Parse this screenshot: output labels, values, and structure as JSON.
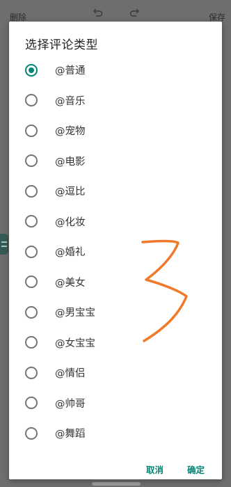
{
  "background": {
    "delete_label": "删除",
    "save_label": "保存"
  },
  "dialog": {
    "title": "选择评论类型",
    "options": [
      {
        "label": "@普通",
        "checked": true
      },
      {
        "label": "@音乐",
        "checked": false
      },
      {
        "label": "@宠物",
        "checked": false
      },
      {
        "label": "@电影",
        "checked": false
      },
      {
        "label": "@逗比",
        "checked": false
      },
      {
        "label": "@化妆",
        "checked": false
      },
      {
        "label": "@婚礼",
        "checked": false
      },
      {
        "label": "@美女",
        "checked": false
      },
      {
        "label": "@男宝宝",
        "checked": false
      },
      {
        "label": "@女宝宝",
        "checked": false
      },
      {
        "label": "@情侣",
        "checked": false
      },
      {
        "label": "@帅哥",
        "checked": false
      },
      {
        "label": "@舞蹈",
        "checked": false
      }
    ],
    "cancel_label": "取消",
    "ok_label": "确定"
  },
  "colors": {
    "accent": "#008577",
    "handwriting": "#f07a2a"
  }
}
